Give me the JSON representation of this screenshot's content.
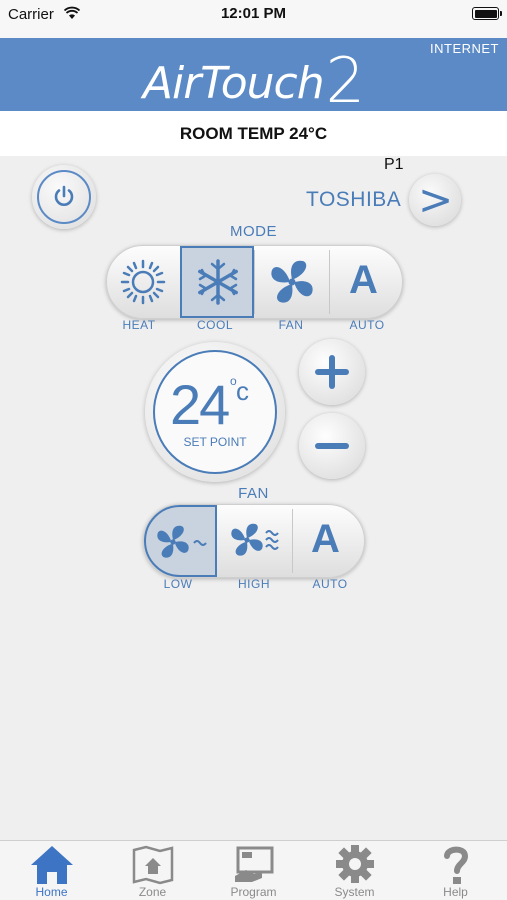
{
  "status_bar": {
    "carrier": "Carrier",
    "time": "12:01 PM"
  },
  "header": {
    "logo_text": "AirTouch",
    "logo_number": "2",
    "connection": "INTERNET"
  },
  "room_temp": "ROOM TEMP 24°C",
  "unit": {
    "position": "P1",
    "brand": "TOSHIBA",
    "next_symbol": ">"
  },
  "mode": {
    "title": "MODE",
    "options": [
      {
        "label": "HEAT",
        "icon": "sun-icon"
      },
      {
        "label": "COOL",
        "icon": "snowflake-icon",
        "selected": true
      },
      {
        "label": "FAN",
        "icon": "fan-icon"
      },
      {
        "label": "AUTO",
        "icon": "auto-a-icon",
        "glyph": "A"
      }
    ]
  },
  "setpoint": {
    "value": "24",
    "degree": "o",
    "unit": "c",
    "label": "SET POINT"
  },
  "fan": {
    "title": "FAN",
    "options": [
      {
        "label": "LOW",
        "icon": "fan-low-icon",
        "selected": true
      },
      {
        "label": "HIGH",
        "icon": "fan-high-icon"
      },
      {
        "label": "AUTO",
        "icon": "auto-a-icon",
        "glyph": "A"
      }
    ]
  },
  "tabs": [
    {
      "label": "Home",
      "icon": "home-icon",
      "active": true
    },
    {
      "label": "Zone",
      "icon": "zone-map-icon"
    },
    {
      "label": "Program",
      "icon": "program-icon"
    },
    {
      "label": "System",
      "icon": "gear-icon"
    },
    {
      "label": "Help",
      "icon": "question-icon"
    }
  ],
  "colors": {
    "accent": "#4a7cb8",
    "header": "#5b8ac6",
    "selected_bg": "#c9d3df"
  }
}
